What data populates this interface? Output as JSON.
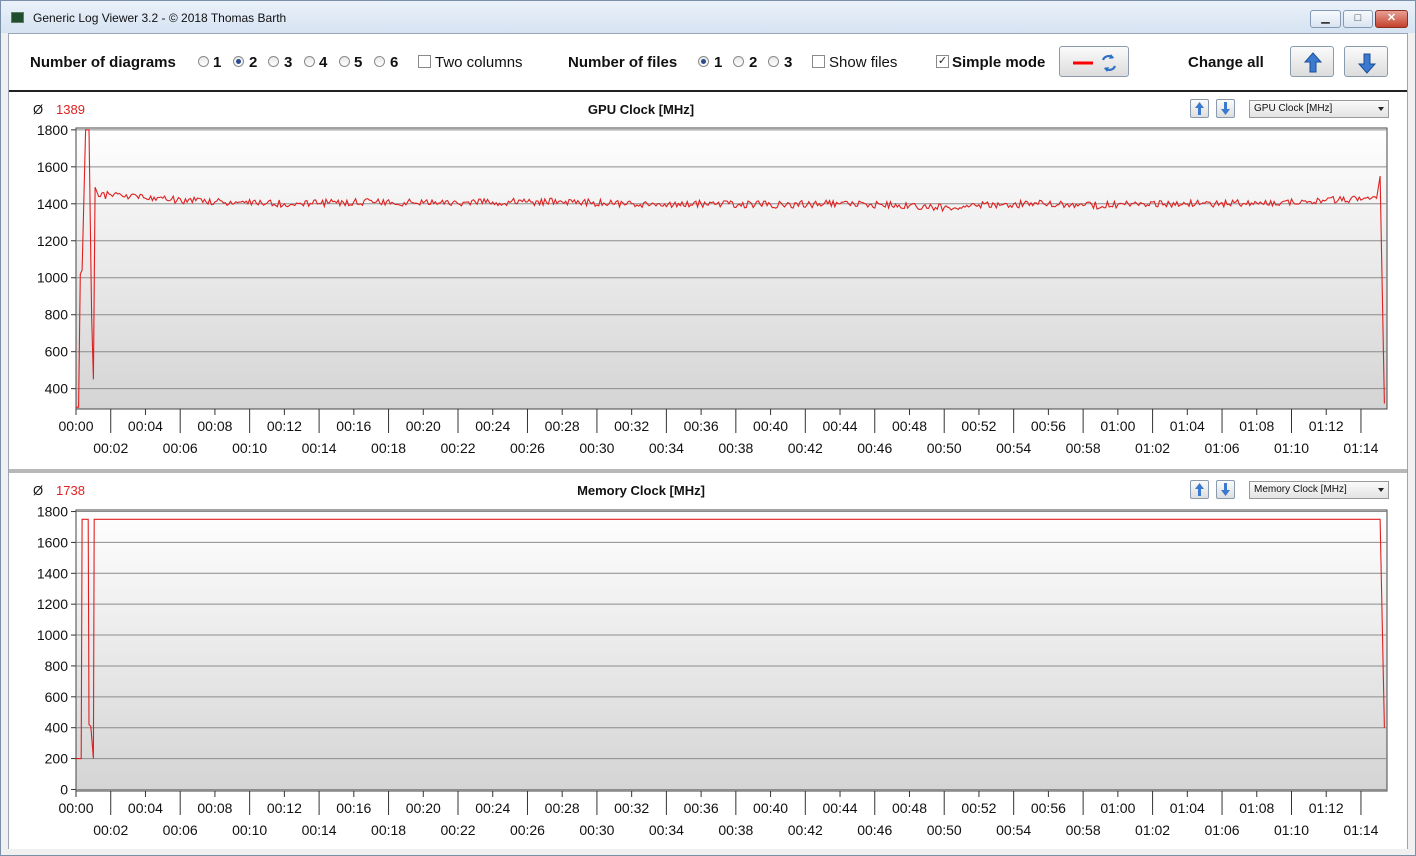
{
  "window": {
    "title": "Generic Log Viewer 3.2 - © 2018 Thomas Barth",
    "min_label": "▁",
    "max_label": "□",
    "close_label": "✕"
  },
  "toolbar": {
    "diagrams_label": "Number of diagrams",
    "diagram_options": [
      "1",
      "2",
      "3",
      "4",
      "5",
      "6"
    ],
    "diagrams_selected": "2",
    "two_columns_label": "Two columns",
    "two_columns_checked": false,
    "files_label": "Number of files",
    "file_options": [
      "1",
      "2",
      "3"
    ],
    "files_selected": "1",
    "show_files_label": "Show files",
    "show_files_checked": false,
    "simple_mode_label": "Simple mode",
    "simple_mode_checked": true,
    "change_all_label": "Change all",
    "line_color": "#ff0000",
    "icons": {
      "style_button": "red-line-refresh-icon",
      "up_button": "arrow-up-icon",
      "down_button": "arrow-down-icon"
    }
  },
  "colors": {
    "series": "#e02020",
    "accent": "#2f6fc4"
  },
  "chart_data": [
    {
      "type": "line",
      "title": "GPU Clock [MHz]",
      "average_symbol": "Ø",
      "average": "1389",
      "selector_value": "GPU Clock [MHz]",
      "ylim": [
        290,
        1810
      ],
      "yticks": [
        400,
        600,
        800,
        1000,
        1200,
        1400,
        1600,
        1800
      ],
      "xlim_minutes": [
        0,
        75.5
      ],
      "xtick_labels_top": [
        "00:00",
        "00:04",
        "00:08",
        "00:12",
        "00:16",
        "00:20",
        "00:24",
        "00:28",
        "00:32",
        "00:36",
        "00:40",
        "00:44",
        "00:48",
        "00:52",
        "00:56",
        "01:00",
        "01:04",
        "01:08",
        "01:12"
      ],
      "xtick_labels_bottom": [
        "00:02",
        "00:06",
        "00:10",
        "00:14",
        "00:18",
        "00:22",
        "00:26",
        "00:30",
        "00:34",
        "00:38",
        "00:42",
        "00:46",
        "00:50",
        "00:54",
        "00:58",
        "01:02",
        "01:06",
        "01:10",
        "01:14"
      ],
      "series": [
        {
          "x": [
            0,
            0.15,
            0.25,
            0.35,
            0.55,
            0.75,
            0.9,
            1.0,
            1.1,
            1.3,
            2,
            4,
            8,
            12,
            16,
            20,
            24,
            28,
            32,
            36,
            40,
            44,
            48,
            50,
            52,
            56,
            58,
            60,
            64,
            68,
            72,
            74.9,
            75.1,
            75.35
          ],
          "y": [
            300,
            300,
            1020,
            1040,
            1800,
            1800,
            800,
            450,
            1490,
            1440,
            1450,
            1430,
            1410,
            1400,
            1410,
            1405,
            1410,
            1410,
            1400,
            1400,
            1395,
            1400,
            1390,
            1380,
            1395,
            1400,
            1390,
            1395,
            1400,
            1405,
            1420,
            1430,
            1550,
            320
          ]
        }
      ]
    },
    {
      "type": "line",
      "title": "Memory Clock [MHz]",
      "average_symbol": "Ø",
      "average": "1738",
      "selector_value": "Memory Clock [MHz]",
      "ylim": [
        -10,
        1810
      ],
      "yticks": [
        0,
        200,
        400,
        600,
        800,
        1000,
        1200,
        1400,
        1600,
        1800
      ],
      "xlim_minutes": [
        0,
        75.5
      ],
      "xtick_labels_top": [
        "00:00",
        "00:04",
        "00:08",
        "00:12",
        "00:16",
        "00:20",
        "00:24",
        "00:28",
        "00:32",
        "00:36",
        "00:40",
        "00:44",
        "00:48",
        "00:52",
        "00:56",
        "01:00",
        "01:04",
        "01:08",
        "01:12"
      ],
      "xtick_labels_bottom": [
        "00:02",
        "00:06",
        "00:10",
        "00:14",
        "00:18",
        "00:22",
        "00:26",
        "00:30",
        "00:34",
        "00:38",
        "00:42",
        "00:46",
        "00:50",
        "00:54",
        "00:58",
        "01:02",
        "01:06",
        "01:10",
        "01:14"
      ],
      "series": [
        {
          "x": [
            0,
            0.3,
            0.35,
            0.7,
            0.75,
            0.85,
            1.0,
            1.05,
            75.1,
            75.35
          ],
          "y": [
            200,
            200,
            1750,
            1750,
            420,
            410,
            200,
            1750,
            1750,
            400
          ]
        }
      ]
    }
  ]
}
